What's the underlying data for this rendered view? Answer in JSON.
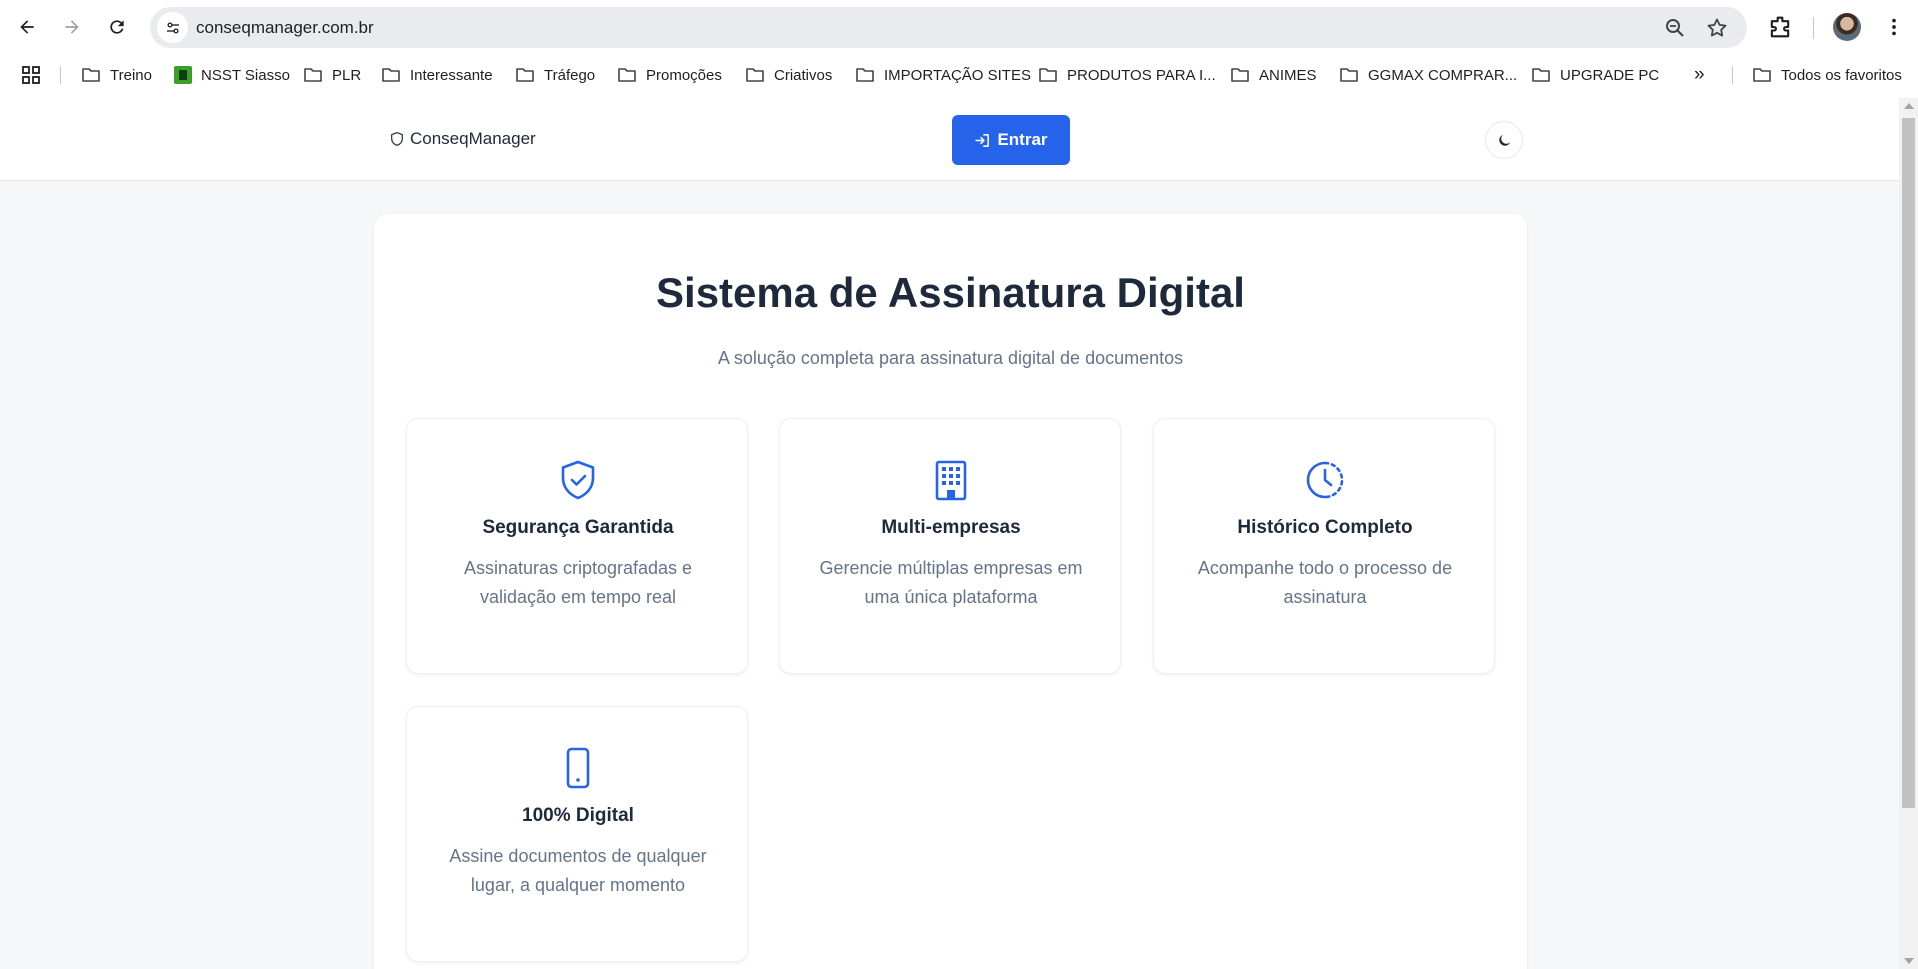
{
  "browser": {
    "url": "conseqmanager.com.br",
    "icons": {
      "back": "arrow-left-icon",
      "forward": "arrow-right-icon",
      "reload": "reload-icon",
      "site_info": "tune-icon",
      "zoom": "zoom-icon",
      "bookmark": "star-icon",
      "extensions": "puzzle-icon",
      "menu": "more-vert-icon"
    },
    "bookmarks": [
      {
        "label": "Treino",
        "icon": "folder-icon"
      },
      {
        "label": "NSST Siasso",
        "icon": "site-favicon"
      },
      {
        "label": "PLR",
        "icon": "folder-icon"
      },
      {
        "label": "Interessante",
        "icon": "folder-icon"
      },
      {
        "label": "Tráfego",
        "icon": "folder-icon"
      },
      {
        "label": "Promoções",
        "icon": "folder-icon"
      },
      {
        "label": "Criativos",
        "icon": "folder-icon"
      },
      {
        "label": "IMPORTAÇÃO SITES",
        "icon": "folder-icon"
      },
      {
        "label": "PRODUTOS PARA I...",
        "icon": "folder-icon"
      },
      {
        "label": "ANIMES",
        "icon": "folder-icon"
      },
      {
        "label": "GGMAX COMPRAR...",
        "icon": "folder-icon"
      },
      {
        "label": "UPGRADE PC",
        "icon": "folder-icon"
      }
    ],
    "bookmarks_overflow": "»",
    "all_bookmarks_label": "Todos os favoritos"
  },
  "header": {
    "brand": "ConseqManager",
    "login_label": "Entrar",
    "theme_icon": "moon-icon"
  },
  "hero": {
    "title": "Sistema de Assinatura Digital",
    "subtitle": "A solução completa para assinatura digital de documentos"
  },
  "features": [
    {
      "icon": "shield-check-icon",
      "title": "Segurança Garantida",
      "description": "Assinaturas criptografadas e validação em tempo real"
    },
    {
      "icon": "building-icon",
      "title": "Multi-empresas",
      "description": "Gerencie múltiplas empresas em uma única plataforma"
    },
    {
      "icon": "clock-history-icon",
      "title": "Histórico Completo",
      "description": "Acompanhe todo o processo de assinatura"
    },
    {
      "icon": "smartphone-icon",
      "title": "100% Digital",
      "description": "Assine documentos de qualquer lugar, a qualquer momento"
    }
  ],
  "colors": {
    "accent": "#2563eb",
    "title": "#1e293b",
    "muted": "#64748b",
    "page_bg": "#f6f7f9"
  }
}
